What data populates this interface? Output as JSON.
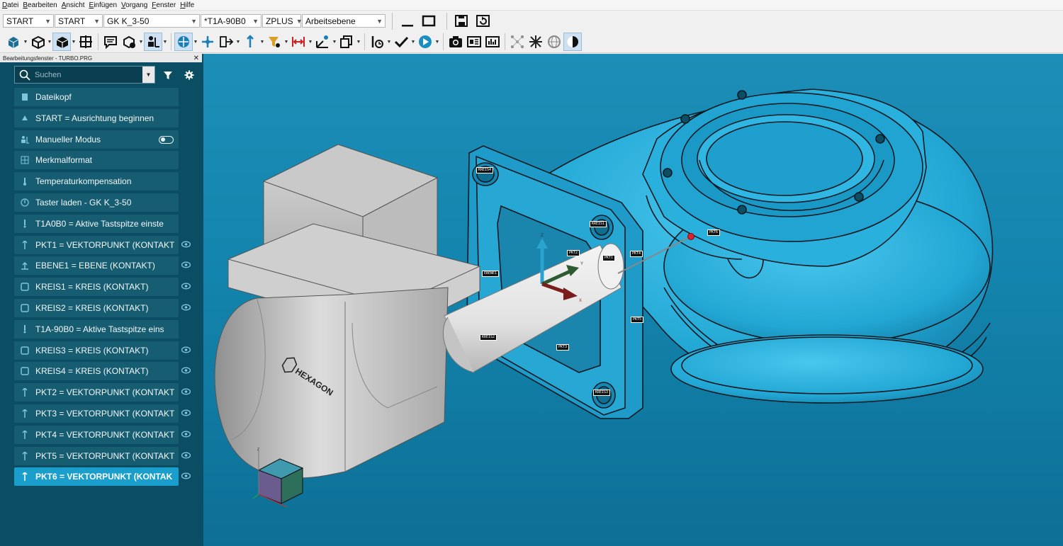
{
  "menu": [
    "Datei",
    "Bearbeiten",
    "Ansicht",
    "Einfügen",
    "Vorgang",
    "Fenster",
    "Hilfe"
  ],
  "toolbar_combos": [
    {
      "value": "START"
    },
    {
      "value": "START"
    },
    {
      "value": "GK K_3-50"
    },
    {
      "value": "*T1A-90B0"
    },
    {
      "value": "ZPLUS"
    },
    {
      "value": "Arbeitsebene"
    }
  ],
  "panel": {
    "title": "Bearbeitungsfenster - TURBO.PRG",
    "search_placeholder": "Suchen"
  },
  "items": [
    {
      "label": "Dateikopf",
      "icon": "file-icon"
    },
    {
      "label": "START = Ausrichtung beginnen",
      "icon": "alignment-icon"
    },
    {
      "label": "Manueller Modus",
      "icon": "manual-mode-icon"
    },
    {
      "label": "Merkmalformat",
      "icon": "format-icon"
    },
    {
      "label": "Temperaturkompensation",
      "icon": "thermometer-icon"
    },
    {
      "label": "Taster laden - GK K_3-50",
      "icon": "probe-load-icon"
    },
    {
      "label": "T1A0B0 = Aktive Tastspitze einste",
      "icon": "tip-icon"
    },
    {
      "label": "PKT1 = VEKTORPUNKT (KONTAKT",
      "icon": "point-icon"
    },
    {
      "label": "EBENE1 = EBENE (KONTAKT)",
      "icon": "plane-icon"
    },
    {
      "label": "KREIS1 = KREIS (KONTAKT)",
      "icon": "circle-icon"
    },
    {
      "label": "KREIS2 = KREIS (KONTAKT)",
      "icon": "circle-icon"
    },
    {
      "label": "T1A-90B0 = Aktive Tastspitze eins",
      "icon": "tip-icon"
    },
    {
      "label": "KREIS3 = KREIS (KONTAKT)",
      "icon": "circle-icon"
    },
    {
      "label": "KREIS4 = KREIS (KONTAKT)",
      "icon": "circle-icon"
    },
    {
      "label": "PKT2 = VEKTORPUNKT (KONTAKT",
      "icon": "point-icon"
    },
    {
      "label": "PKT3 = VEKTORPUNKT (KONTAKT",
      "icon": "point-icon"
    },
    {
      "label": "PKT4 = VEKTORPUNKT (KONTAKT",
      "icon": "point-icon"
    },
    {
      "label": "PKT5 = VEKTORPUNKT (KONTAKT",
      "icon": "point-icon"
    },
    {
      "label": "PKT6 = VEKTORPUNKT (KONTAK",
      "icon": "point-icon"
    }
  ],
  "viewport": {
    "brand_text": "HEXAGON",
    "tags": [
      "KREIS4",
      "KREIS1",
      "EBENE1",
      "PKT2",
      "PKT1",
      "PKT4",
      "PKT6",
      "PKT3",
      "PKT5",
      "KREIS2",
      "KREIS3"
    ],
    "axes": {
      "x": "X",
      "y": "Y",
      "z": "Z"
    }
  }
}
